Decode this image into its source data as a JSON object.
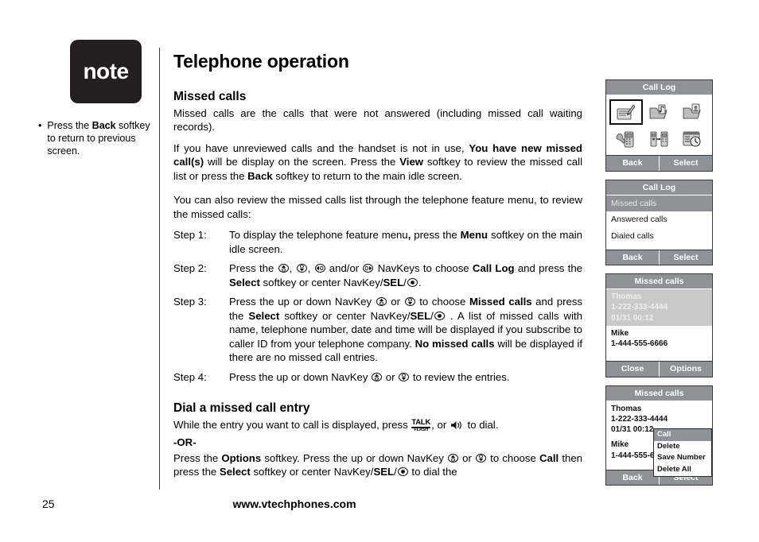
{
  "note": {
    "badge_label": "note",
    "bullets": [
      {
        "pre": "Press the ",
        "bold": "Back",
        "post": " softkey to return to previous screen."
      }
    ]
  },
  "main": {
    "title": "Telephone operation",
    "section1_heading": "Missed calls",
    "p1": "Missed calls are the calls that were not answered (including missed call waiting records).",
    "p2_a": "If you have unreviewed calls and the handset is not in use, ",
    "p2_b1": "You have new missed call(s)",
    "p2_c": " will be display on the screen. Press the ",
    "p2_b2": "View",
    "p2_d": " softkey to review the missed call list or press the ",
    "p2_b3": "Back",
    "p2_e": " softkey to return to the main idle screen.",
    "p3": "You can also review the missed calls list through the telephone feature menu, to review the missed calls:",
    "steps": [
      {
        "label": "Step 1:",
        "a": "To display the telephone feature menu",
        "b1": ",",
        "c": " press the ",
        "b2": "Menu",
        "d": " softkey on the main idle screen."
      },
      {
        "label": "Step 2:",
        "a": "Press the ",
        "b1": "",
        "c": " and/or ",
        "d": " NavKeys to choose ",
        "b2": "Call Log",
        "e": " and press the ",
        "b3": "Select",
        "f": " softkey or center NavKey/",
        "b4": "SEL",
        "g": "/",
        "h": "."
      },
      {
        "label": "Step 3:",
        "a": "Press the up or down NavKey ",
        "c": " or ",
        "d": " to choose ",
        "b2": "Missed calls",
        "e": " and press the ",
        "b3": "Select",
        "f": " softkey or center NavKey/",
        "b4": "SEL",
        "g": "/",
        "h": " . A list of missed calls with name, telephone number, date and time will be displayed if you subscribe to caller ID from your telephone company. ",
        "b5": "No missed calls",
        "i": " will be displayed if there are no missed call entries."
      },
      {
        "label": "Step 4:",
        "a": "Press the up or down NavKey ",
        "c": " or ",
        "d": " to review the entries."
      }
    ],
    "section2_heading": "Dial a missed call entry",
    "p4_a": "While the entry you want to call is displayed, press ",
    "talk_key_top": "TALK",
    "talk_key_bottom": "FLASH",
    "p4_b": ", or ",
    "p4_c": " to dial.",
    "or_label": "-OR-",
    "p5_a": "Press the ",
    "p5_b1": "Options",
    "p5_c": " softkey. Press the up or down NavKey ",
    "p5_d": " or ",
    "p5_e": " to choose ",
    "p5_b2": "Call",
    "p5_f": " then press the ",
    "p5_b3": "Select",
    "p5_g": " softkey or center NavKey/",
    "p5_b4": "SEL",
    "p5_h": "/",
    "p5_i": " to dial the"
  },
  "footer": {
    "page_number": "25",
    "website": "www.vtechphones.com"
  },
  "screens": [
    {
      "id": "call-log-menu",
      "title": "Call Log",
      "icons": [
        {
          "name": "call-log-icon",
          "selected": true
        },
        {
          "name": "voicemail-folder-icon",
          "selected": false
        },
        {
          "name": "phonebook-folder-icon",
          "selected": false
        },
        {
          "name": "handset-settings-icon",
          "selected": false
        },
        {
          "name": "handset-registration-icon",
          "selected": false
        },
        {
          "name": "clock-alarm-icon",
          "selected": false
        }
      ],
      "softkeys": {
        "left": "Back",
        "right": "Select"
      }
    },
    {
      "id": "call-log-list",
      "title": "Call Log",
      "rows": [
        {
          "label": "Missed calls",
          "selected": true
        },
        {
          "label": "Answered calls",
          "selected": false
        },
        {
          "label": "Dialed calls",
          "selected": false
        }
      ],
      "softkeys": {
        "left": "Back",
        "right": "Select"
      }
    },
    {
      "id": "missed-calls-list",
      "title": "Missed calls",
      "entries": [
        {
          "name": "Thomas",
          "number": "1-222-333-4444",
          "datetime": "01/31 00:12",
          "selected": true
        },
        {
          "name": "Mike",
          "number": "1-444-555-6666",
          "datetime": "",
          "selected": false
        }
      ],
      "softkeys": {
        "left": "Close",
        "right": "Options"
      }
    },
    {
      "id": "missed-calls-options",
      "title": "Missed calls",
      "entries": [
        {
          "name": "Thomas",
          "number": "1-222-333-4444",
          "datetime": "01/31 00:12",
          "selected": false
        },
        {
          "name": "Mike",
          "number": "1-444-555-6",
          "datetime": "",
          "selected": false
        }
      ],
      "popup": [
        {
          "label": "Call",
          "selected": true
        },
        {
          "label": "Delete",
          "selected": false
        },
        {
          "label": "Save Number",
          "selected": false
        },
        {
          "label": "Delete All",
          "selected": false
        }
      ],
      "softkeys": {
        "left": "Back",
        "right": "Select"
      }
    }
  ],
  "colors": {
    "header_gray": "#8f9296",
    "selected_gray": "#c9c9c9",
    "badge_black": "#231f20",
    "rule": "#3a3a3a"
  }
}
